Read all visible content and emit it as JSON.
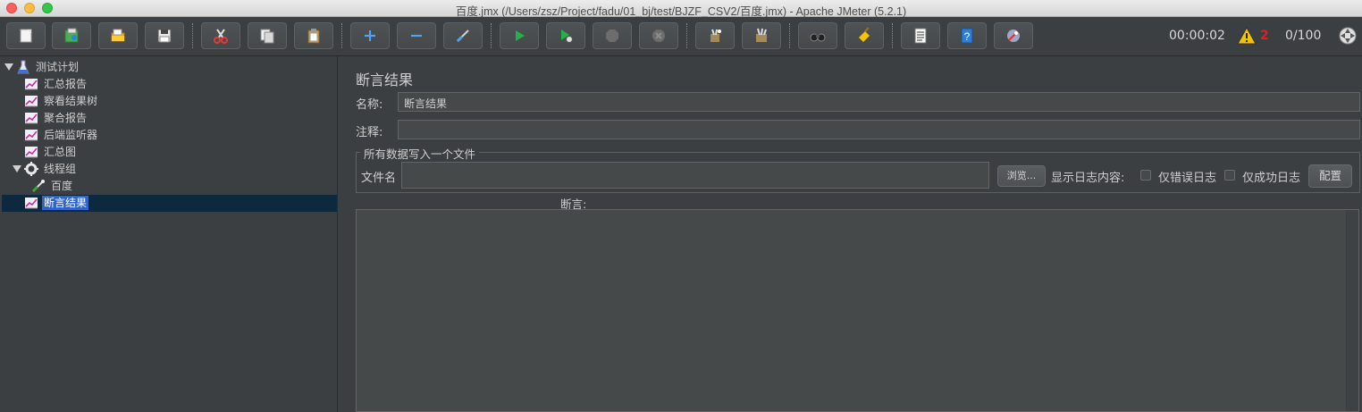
{
  "window": {
    "title": "百度.jmx (/Users/zsz/Project/fadu/01_bj/test/BJZF_CSV2/百度.jmx) - Apache JMeter (5.2.1)"
  },
  "toolbar": {
    "buttons": [
      {
        "icon": "new-icon"
      },
      {
        "icon": "templates-icon"
      },
      {
        "icon": "open-icon"
      },
      {
        "icon": "save-icon"
      },
      {
        "icon": "cut-icon"
      },
      {
        "icon": "copy-icon"
      },
      {
        "icon": "paste-icon"
      },
      {
        "icon": "expand-icon"
      },
      {
        "icon": "collapse-icon"
      },
      {
        "icon": "toggle-icon"
      },
      {
        "icon": "start-icon"
      },
      {
        "icon": "start-no-pauses-icon"
      },
      {
        "icon": "stop-icon"
      },
      {
        "icon": "shutdown-icon"
      },
      {
        "icon": "clear-icon"
      },
      {
        "icon": "clear-all-icon"
      },
      {
        "icon": "search-icon"
      },
      {
        "icon": "reset-search-icon"
      },
      {
        "icon": "function-helper-icon"
      },
      {
        "icon": "help-icon"
      },
      {
        "icon": "remote-icon"
      }
    ],
    "elapsed_time": "00:00:02",
    "warning_count": "2",
    "threads": "0/100"
  },
  "tree": {
    "items": [
      {
        "label": "测试计划",
        "icon": "test-plan-icon",
        "expanded": true
      },
      {
        "label": "汇总报告",
        "icon": "listener-icon"
      },
      {
        "label": "察看结果树",
        "icon": "listener-icon"
      },
      {
        "label": "聚合报告",
        "icon": "listener-icon"
      },
      {
        "label": "后端监听器",
        "icon": "listener-icon"
      },
      {
        "label": "汇总图",
        "icon": "listener-icon"
      },
      {
        "label": "线程组",
        "icon": "thread-group-icon",
        "expanded": true
      },
      {
        "label": "百度",
        "icon": "sampler-icon"
      },
      {
        "label": "断言结果",
        "icon": "listener-icon",
        "selected": true
      }
    ]
  },
  "panel": {
    "title": "断言结果",
    "name_label": "名称:",
    "name_value": "断言结果",
    "comment_label": "注释:",
    "comment_value": "",
    "file_group_title": "所有数据写入一个文件",
    "filename_label": "文件名",
    "filename_value": "",
    "browse_button": "浏览...",
    "log_display_label": "显示日志内容:",
    "errors_only_label": "仅错误日志",
    "success_only_label": "仅成功日志",
    "configure_button": "配置",
    "assertions_header": "断言:"
  },
  "colors": {
    "background": "#3c3f41",
    "selection": "#2f65ca",
    "warning_count": "#e02020"
  }
}
